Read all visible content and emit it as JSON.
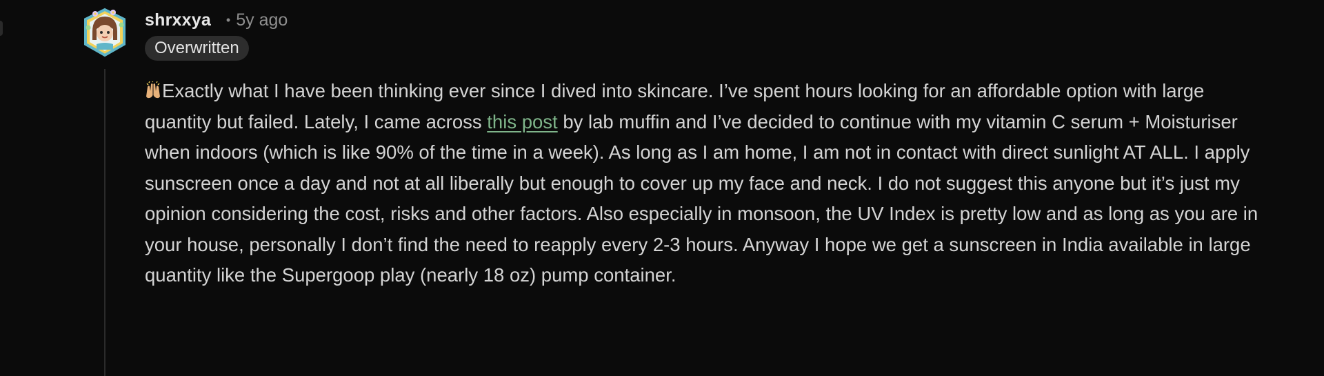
{
  "comment": {
    "username": "shrxxya",
    "separator": "•",
    "timestamp": "5y ago",
    "flair": "Overwritten",
    "emoji_icon": "raising-hands-icon",
    "avatar_icon": "snoo-avatar-icon",
    "body": {
      "text_before_link": "Exactly what I have been thinking ever since I dived into skincare. I’ve spent hours looking for an affordable option with large quantity but failed. Lately, I came across ",
      "link_text": "this post",
      "text_after_link": " by lab muffin and I’ve decided to continue with my vitamin C serum + Moisturiser when indoors (which is like 90% of the time in a week). As long as I am home, I am not in contact with direct sunlight AT ALL. I apply sunscreen once a day and not at all liberally but enough to cover up my face and neck. I do not suggest this anyone but it’s just my opinion considering the cost, risks and other factors. Also especially in monsoon, the UV Index is pretty low and as long as you are in your house, personally I don’t find the need to reapply every 2-3 hours. Anyway I hope we get a sunscreen in India available in large quantity like the Supergoop play (nearly 18 oz) pump container."
    }
  },
  "colors": {
    "background": "#0b0b0b",
    "text": "#d4d4d4",
    "link": "#7fb58a",
    "flair_bg": "#2d2d2d",
    "muted": "#8e8e8e"
  }
}
